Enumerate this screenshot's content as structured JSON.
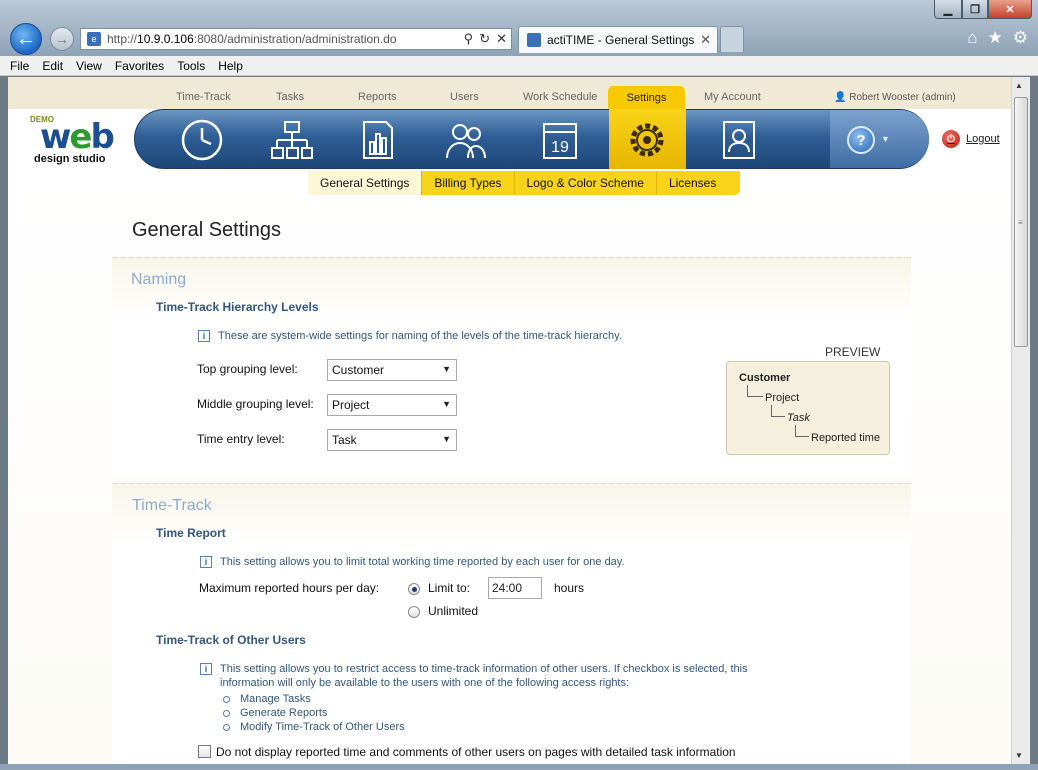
{
  "window": {
    "min": "▁",
    "max": "❐",
    "close": "✕"
  },
  "browser": {
    "url_prefix": "http://",
    "url_host": "10.9.0.106",
    "url_path": ":8080/administration/administration.do",
    "tab_title": "actiTIME - General Settings",
    "tab_close": "✕",
    "menu": [
      "File",
      "Edit",
      "View",
      "Favorites",
      "Tools",
      "Help"
    ]
  },
  "app": {
    "top_tabs": [
      "Time-Track",
      "Tasks",
      "Reports",
      "Users",
      "Work Schedule",
      "Settings",
      "My Account"
    ],
    "user": "Robert Wooster (admin)",
    "logout": "Logout",
    "logo": {
      "demo": "DEMO",
      "w": "w",
      "e": "e",
      "b": "b",
      "studio": "design studio"
    },
    "sub_tabs": [
      "General Settings",
      "Billing Types",
      "Logo & Color Scheme",
      "Licenses"
    ],
    "calendar_day": "19"
  },
  "page": {
    "title": "General Settings",
    "naming": {
      "title": "Naming",
      "subtitle": "Time-Track Hierarchy Levels",
      "info": "These are system-wide settings for naming of the levels of the time-track hierarchy.",
      "fields": [
        {
          "label": "Top grouping level:",
          "value": "Customer"
        },
        {
          "label": "Middle grouping level:",
          "value": "Project"
        },
        {
          "label": "Time entry level:",
          "value": "Task"
        }
      ],
      "preview": {
        "label": "PREVIEW",
        "customer": "Customer",
        "project": "Project",
        "task": "Task",
        "reported": "Reported time"
      }
    },
    "timetrack": {
      "title": "Time-Track",
      "report_subtitle": "Time Report",
      "report_info": "This setting allows you to limit total working time reported by each user for one day.",
      "max_label": "Maximum reported hours per day:",
      "limit_label": "Limit to:",
      "limit_value": "24:00",
      "hours": "hours",
      "unlimited": "Unlimited",
      "others_subtitle": "Time-Track of Other Users",
      "others_info_1": "This setting allows you to restrict access to time-track information of other users. If checkbox is selected, this",
      "others_info_2": "information will only be available to the users with one of the following access rights:",
      "rights": [
        "Manage Tasks",
        "Generate Reports",
        "Modify Time-Track of Other Users"
      ],
      "checkbox_label": "Do not display reported time and comments of other users on pages with detailed task information"
    }
  }
}
